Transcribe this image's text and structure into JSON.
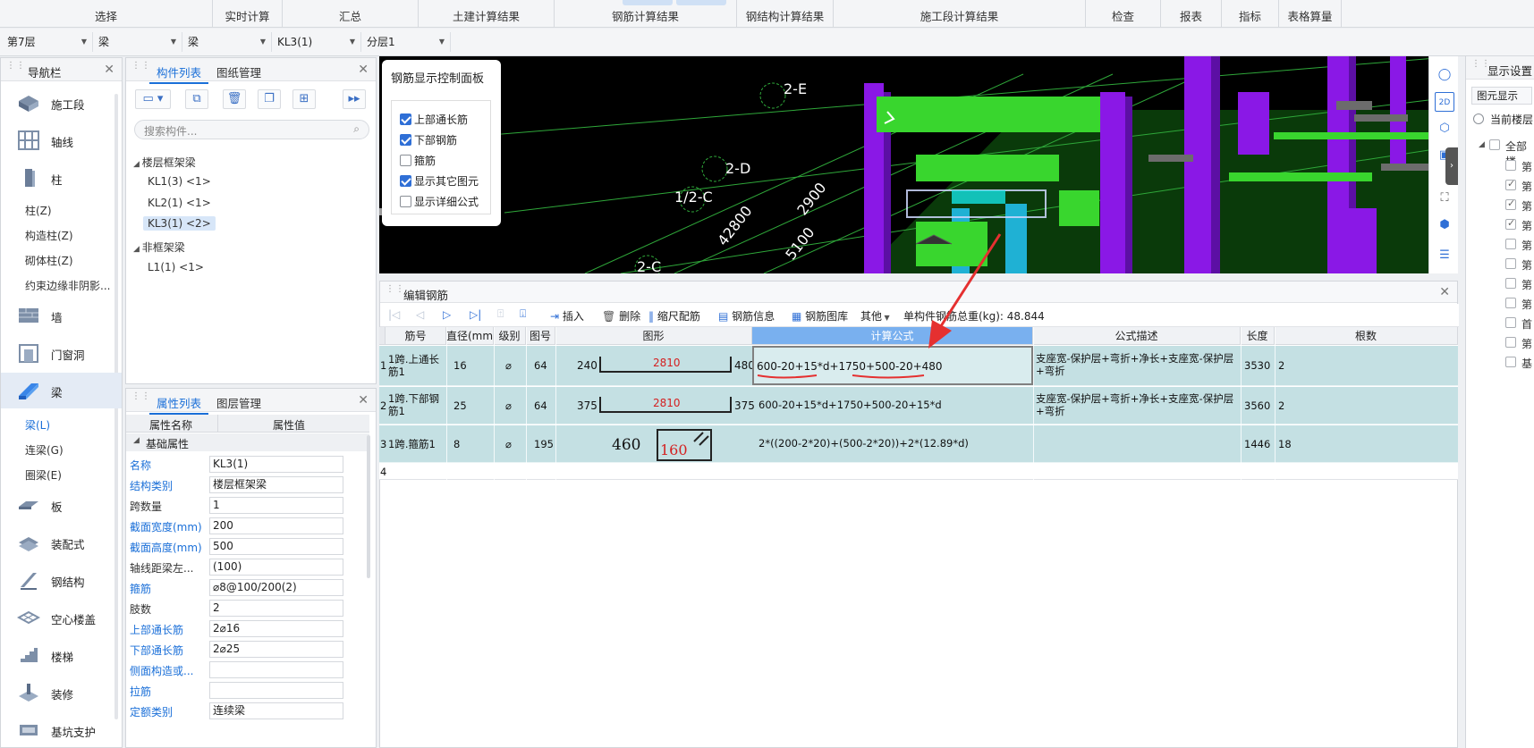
{
  "ribbon": {
    "tabs": [
      "选择",
      "实时计算",
      "汇总",
      "土建计算结果",
      "钢筋计算结果",
      "钢结构计算结果",
      "施工段计算结果",
      "检查",
      "报表",
      "指标",
      "表格算量"
    ]
  },
  "combos": {
    "floor": "第7层",
    "category": "梁",
    "type": "梁",
    "element": "KL3(1)",
    "layer": "分层1"
  },
  "nav": {
    "title": "导航栏",
    "items": [
      {
        "label": "施工段",
        "icon": "construction-segment-icon"
      },
      {
        "label": "轴线",
        "icon": "axis-grid-icon"
      },
      {
        "label": "柱",
        "icon": "column-icon"
      },
      {
        "label": "墙",
        "icon": "wall-icon"
      },
      {
        "label": "门窗洞",
        "icon": "door-window-icon"
      },
      {
        "label": "梁",
        "icon": "beam-icon"
      },
      {
        "label": "板",
        "icon": "slab-icon"
      },
      {
        "label": "装配式",
        "icon": "prefab-icon"
      },
      {
        "label": "钢结构",
        "icon": "steel-structure-icon"
      },
      {
        "label": "空心楼盖",
        "icon": "hollow-floor-icon"
      },
      {
        "label": "楼梯",
        "icon": "stair-icon"
      },
      {
        "label": "装修",
        "icon": "decoration-icon"
      },
      {
        "label": "基坑支护",
        "icon": "pit-support-icon"
      }
    ],
    "column_subs": [
      "柱(Z)",
      "构造柱(Z)",
      "砌体柱(Z)",
      "约束边缘非阴影..."
    ],
    "beam_subs": [
      "梁(L)",
      "连梁(G)",
      "圈梁(E)"
    ]
  },
  "component_list": {
    "tab1": "构件列表",
    "tab2": "图纸管理",
    "search_placeholder": "搜索构件...",
    "group1": "楼层框架梁",
    "items1": [
      "KL1(3) <1>",
      "KL2(1) <1>",
      "KL3(1) <2>"
    ],
    "group2": "非框架梁",
    "items2": [
      "L1(1) <1>"
    ]
  },
  "properties": {
    "tab1": "属性列表",
    "tab2": "图层管理",
    "col_name": "属性名称",
    "col_value": "属性值",
    "section": "基础属性",
    "rows": [
      {
        "k": "名称",
        "v": "KL3(1)"
      },
      {
        "k": "结构类别",
        "v": "楼层框架梁"
      },
      {
        "k": "跨数量",
        "v": "1"
      },
      {
        "k": "截面宽度(mm)",
        "v": "200"
      },
      {
        "k": "截面高度(mm)",
        "v": "500"
      },
      {
        "k": "轴线距梁左...",
        "v": "(100)"
      },
      {
        "k": "箍筋",
        "v": "⌀8@100/200(2)"
      },
      {
        "k": "肢数",
        "v": "2"
      },
      {
        "k": "上部通长筋",
        "v": "2⌀16"
      },
      {
        "k": "下部通长筋",
        "v": "2⌀25"
      },
      {
        "k": "侧面构造或...",
        "v": ""
      },
      {
        "k": "拉筋",
        "v": ""
      },
      {
        "k": "定额类别",
        "v": "连续梁"
      }
    ]
  },
  "viewport": {
    "labels": [
      "2-E",
      "2-D",
      "1/2-C",
      "2-C",
      "42800",
      "2900",
      "5100"
    ]
  },
  "control_panel": {
    "title": "钢筋显示控制面板",
    "options": [
      {
        "label": "上部通长筋",
        "checked": true
      },
      {
        "label": "下部钢筋",
        "checked": true
      },
      {
        "label": "箍筋",
        "checked": false
      },
      {
        "label": "显示其它图元",
        "checked": true
      },
      {
        "label": "显示详细公式",
        "checked": false
      }
    ]
  },
  "edit_rebar": {
    "title": "编辑钢筋",
    "toolbar": [
      "插入",
      "删除",
      "缩尺配筋",
      "钢筋信息",
      "钢筋图库",
      "其他"
    ],
    "weight_label": "单构件钢筋总重(kg): 48.844",
    "columns": [
      "筋号",
      "直径(mm)",
      "级别",
      "图号",
      "图形",
      "计算公式",
      "公式描述",
      "长度",
      "根数"
    ],
    "rows": [
      {
        "idx": "1",
        "name": "1跨.上通长筋1",
        "dia": "16",
        "grade": "⌀",
        "fig": "64",
        "left": "240",
        "mid": "2810",
        "right": "480",
        "formula": "600-20+15*d+1750+500-20+480",
        "desc": "支座宽-保护层+弯折+净长+支座宽-保护层+弯折",
        "len": "3530",
        "count": "2"
      },
      {
        "idx": "2",
        "name": "1跨.下部钢筋1",
        "dia": "25",
        "grade": "⌀",
        "fig": "64",
        "left": "375",
        "mid": "2810",
        "right": "375",
        "formula": "600-20+15*d+1750+500-20+15*d",
        "desc": "支座宽-保护层+弯折+净长+支座宽-保护层+弯折",
        "len": "3560",
        "count": "2"
      },
      {
        "idx": "3",
        "name": "1跨.箍筋1",
        "dia": "8",
        "grade": "⌀",
        "fig": "195",
        "left": "460",
        "mid": "160",
        "right": "",
        "formula": "2*((200-2*20)+(500-2*20))+2*(12.89*d)",
        "desc": "",
        "len": "1446",
        "count": "18"
      },
      {
        "idx": "4",
        "name": "",
        "dia": "",
        "grade": "",
        "fig": "",
        "left": "",
        "mid": "",
        "right": "",
        "formula": "",
        "desc": "",
        "len": "",
        "count": ""
      }
    ]
  },
  "display_settings": {
    "title": "显示设置",
    "tab": "图元显示",
    "radio": "当前楼层",
    "all": "全部楼",
    "items": [
      "第",
      "第",
      "第",
      "第",
      "第",
      "第",
      "第",
      "第",
      "首",
      "第",
      "基"
    ],
    "checked": [
      false,
      true,
      true,
      true,
      false,
      false,
      false,
      false,
      false,
      false,
      false
    ]
  },
  "colors": {
    "accent": "#1a6fd8",
    "row_bg": "#c4e0e3",
    "selected_header": "#79b0ef",
    "annotation_red": "#e53030",
    "rebar_red": "#d42020"
  }
}
